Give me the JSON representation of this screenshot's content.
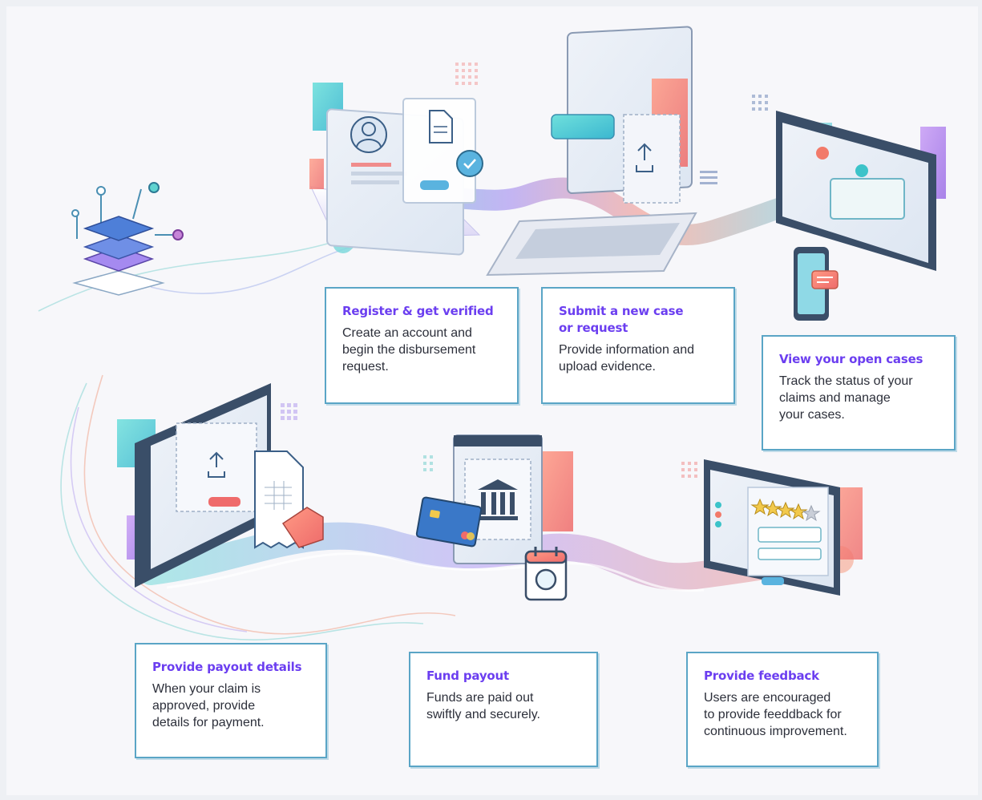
{
  "steps": [
    {
      "title": "Register & get verified",
      "description": "Create an account and\nbegin the disbursement\nrequest."
    },
    {
      "title": "Submit a new case\nor request",
      "description": "Provide information and\nupload evidence."
    },
    {
      "title": "View your open cases",
      "description": "Track the status of your\nclaims and manage\nyour cases."
    },
    {
      "title": "Provide payout details",
      "description": "When your claim is\napproved, provide\ndetails for payment."
    },
    {
      "title": "Fund payout",
      "description": "Funds are paid out\nswiftly and securely."
    },
    {
      "title": "Provide feedback",
      "description": "Users are encouraged\nto provide feeddback for\ncontinuous improvement."
    }
  ],
  "colors": {
    "accent": "#6b3ef0",
    "card_border": "#5aa5c6",
    "teal": "#3cc3c9",
    "coral": "#f27a6a",
    "purple": "#a77be8"
  },
  "icons": [
    "network-node-icon",
    "user-profile-icon",
    "document-icon",
    "checkmark-icon",
    "upload-icon",
    "laptop-icon",
    "monitor-icon",
    "smartphone-icon",
    "chat-icon",
    "invoice-icon",
    "price-tag-icon",
    "bank-icon",
    "credit-card-icon",
    "calendar-icon",
    "star-rating-icon"
  ]
}
